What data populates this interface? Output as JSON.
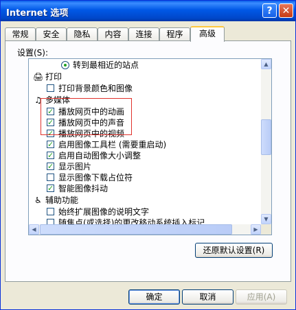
{
  "window": {
    "title": "Internet 选项",
    "help_label": "?",
    "close_label": "✕"
  },
  "tabs": [
    {
      "label": "常规"
    },
    {
      "label": "安全"
    },
    {
      "label": "隐私"
    },
    {
      "label": "内容"
    },
    {
      "label": "连接"
    },
    {
      "label": "程序"
    },
    {
      "label": "高级",
      "active": true
    }
  ],
  "settings": {
    "label": "设置(S):",
    "items": [
      {
        "type": "radio",
        "label": "转到最相近的站点",
        "checked": true
      },
      {
        "type": "category",
        "label": "打印",
        "icon": "printer-icon"
      },
      {
        "type": "checkbox",
        "label": "打印背景颜色和图像",
        "checked": false
      },
      {
        "type": "category",
        "label": "多媒体",
        "icon": "multimedia-icon"
      },
      {
        "type": "checkbox",
        "label": "播放网页中的动画",
        "checked": true
      },
      {
        "type": "checkbox",
        "label": "播放网页中的声音",
        "checked": true
      },
      {
        "type": "checkbox",
        "label": "播放网页中的视频",
        "checked": true
      },
      {
        "type": "checkbox",
        "label": "启用图像工具栏 (需要重启动)",
        "checked": true
      },
      {
        "type": "checkbox",
        "label": "启用自动图像大小调整",
        "checked": true
      },
      {
        "type": "checkbox",
        "label": "显示图片",
        "checked": true
      },
      {
        "type": "checkbox",
        "label": "显示图像下载占位符",
        "checked": false
      },
      {
        "type": "checkbox",
        "label": "智能图像抖动",
        "checked": true
      },
      {
        "type": "category",
        "label": "辅助功能",
        "icon": "accessibility-icon"
      },
      {
        "type": "checkbox",
        "label": "始终扩展图像的说明文字",
        "checked": false
      },
      {
        "type": "checkbox",
        "label": "随焦点(或选择)的更改移动系统插入标记",
        "checked": false
      }
    ]
  },
  "buttons": {
    "restore": "还原默认设置(R)",
    "ok": "确定",
    "cancel": "取消",
    "apply": "应用(A)"
  },
  "colors": {
    "title_bar": "#0058e6",
    "highlight_border": "#e0302a",
    "check": "#21a121"
  }
}
